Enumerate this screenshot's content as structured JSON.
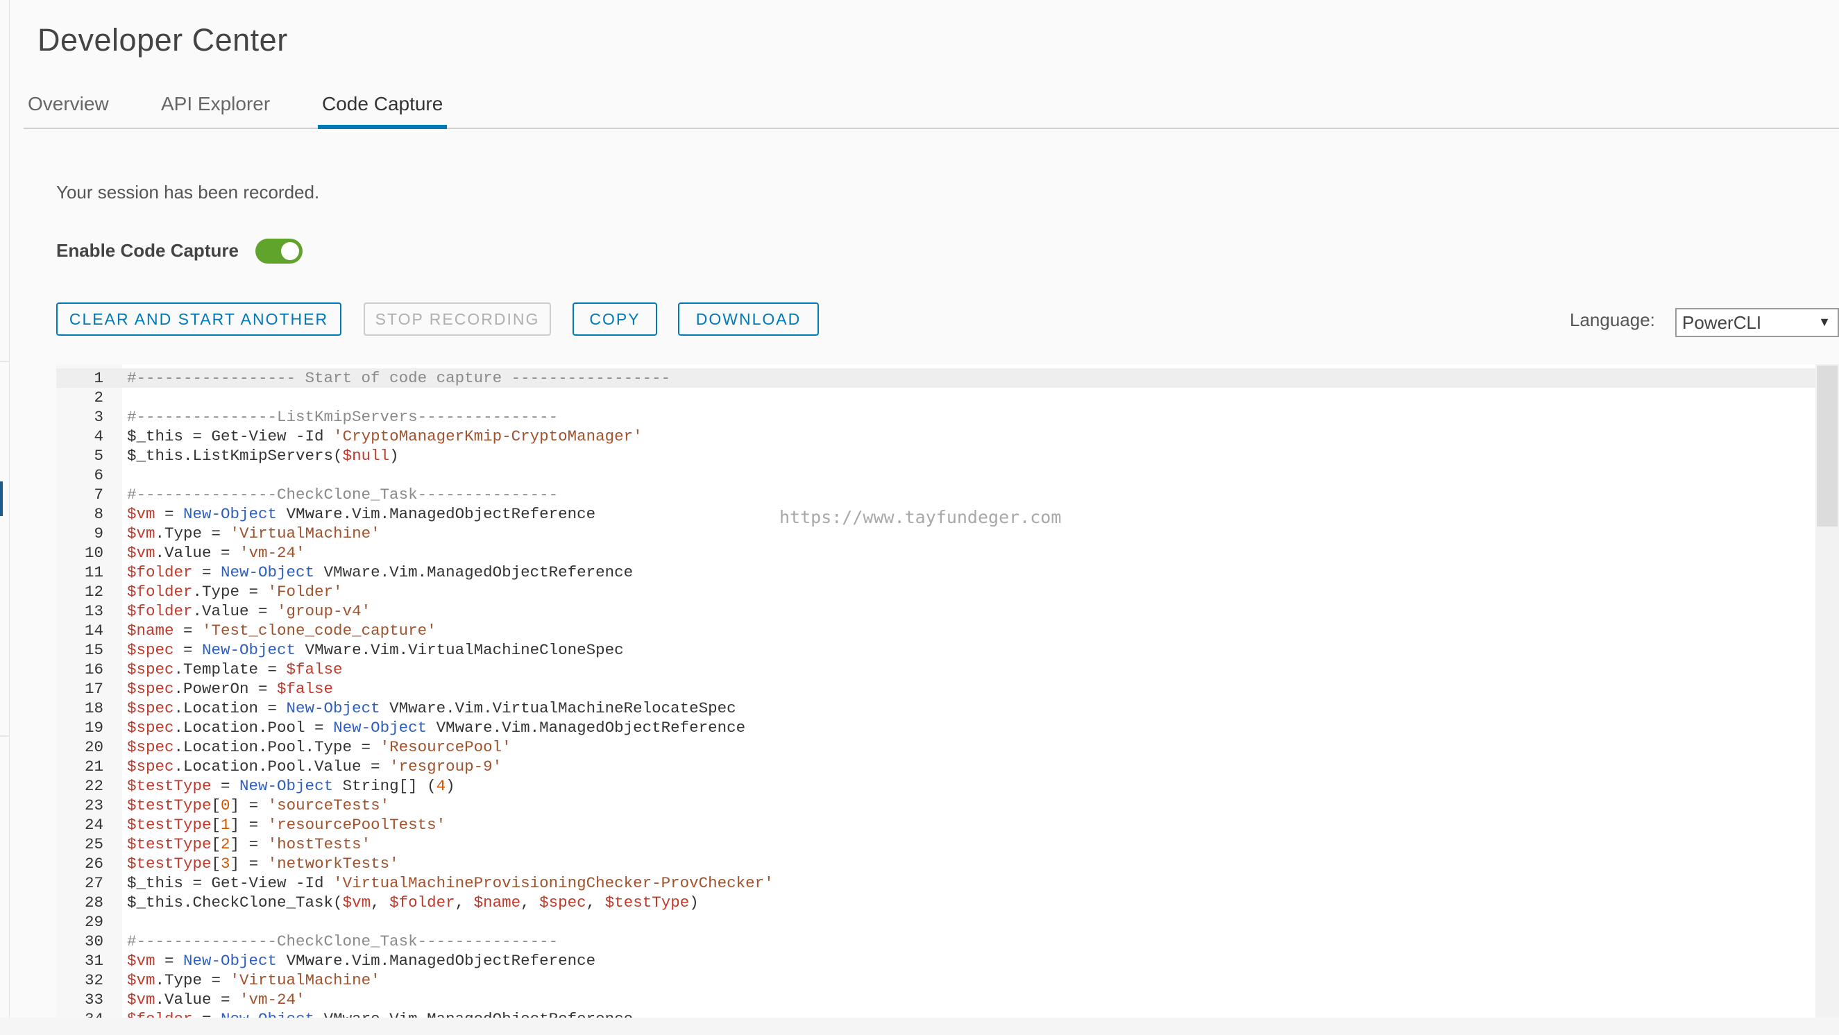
{
  "page": {
    "title": "Developer Center"
  },
  "tabs": [
    {
      "label": "Overview",
      "active": false
    },
    {
      "label": "API Explorer",
      "active": false
    },
    {
      "label": "Code Capture",
      "active": true
    }
  ],
  "session_message": "Your session has been recorded.",
  "toggle": {
    "label": "Enable Code Capture",
    "enabled": true,
    "color": "#61a42b"
  },
  "buttons": {
    "clear_start": "CLEAR AND START ANOTHER",
    "stop_recording": "STOP RECORDING",
    "copy": "COPY",
    "download": "DOWNLOAD"
  },
  "language": {
    "label": "Language:",
    "selected": "PowerCLI"
  },
  "watermark": "https://www.tayfundeger.com",
  "accent_color": "#0079b8",
  "code_lines": [
    [
      [
        "c-com",
        "#----------------- Start of code capture -----------------"
      ]
    ],
    [],
    [
      [
        "c-com",
        "#---------------ListKmipServers---------------"
      ]
    ],
    [
      [
        "",
        "$_this = Get-View -Id "
      ],
      [
        "c-str",
        "'CryptoManagerKmip-CryptoManager'"
      ]
    ],
    [
      [
        "",
        "$_this.ListKmipServers("
      ],
      [
        "c-var",
        "$null"
      ],
      [
        "",
        ")"
      ]
    ],
    [],
    [
      [
        "c-com",
        "#---------------CheckClone_Task---------------"
      ]
    ],
    [
      [
        "c-var",
        "$vm"
      ],
      [
        "",
        " = "
      ],
      [
        "c-kw",
        "New-Object"
      ],
      [
        "",
        " VMware.Vim.ManagedObjectReference"
      ]
    ],
    [
      [
        "c-var",
        "$vm"
      ],
      [
        "",
        ".Type = "
      ],
      [
        "c-str",
        "'VirtualMachine'"
      ]
    ],
    [
      [
        "c-var",
        "$vm"
      ],
      [
        "",
        ".Value = "
      ],
      [
        "c-str",
        "'vm-24'"
      ]
    ],
    [
      [
        "c-var",
        "$folder"
      ],
      [
        "",
        " = "
      ],
      [
        "c-kw",
        "New-Object"
      ],
      [
        "",
        " VMware.Vim.ManagedObjectReference"
      ]
    ],
    [
      [
        "c-var",
        "$folder"
      ],
      [
        "",
        ".Type = "
      ],
      [
        "c-str",
        "'Folder'"
      ]
    ],
    [
      [
        "c-var",
        "$folder"
      ],
      [
        "",
        ".Value = "
      ],
      [
        "c-str",
        "'group-v4'"
      ]
    ],
    [
      [
        "c-var",
        "$name"
      ],
      [
        "",
        " = "
      ],
      [
        "c-str",
        "'Test_clone_code_capture'"
      ]
    ],
    [
      [
        "c-var",
        "$spec"
      ],
      [
        "",
        " = "
      ],
      [
        "c-kw",
        "New-Object"
      ],
      [
        "",
        " VMware.Vim.VirtualMachineCloneSpec"
      ]
    ],
    [
      [
        "c-var",
        "$spec"
      ],
      [
        "",
        ".Template = "
      ],
      [
        "c-var",
        "$false"
      ]
    ],
    [
      [
        "c-var",
        "$spec"
      ],
      [
        "",
        ".PowerOn = "
      ],
      [
        "c-var",
        "$false"
      ]
    ],
    [
      [
        "c-var",
        "$spec"
      ],
      [
        "",
        ".Location = "
      ],
      [
        "c-kw",
        "New-Object"
      ],
      [
        "",
        " VMware.Vim.VirtualMachineRelocateSpec"
      ]
    ],
    [
      [
        "c-var",
        "$spec"
      ],
      [
        "",
        ".Location.Pool = "
      ],
      [
        "c-kw",
        "New-Object"
      ],
      [
        "",
        " VMware.Vim.ManagedObjectReference"
      ]
    ],
    [
      [
        "c-var",
        "$spec"
      ],
      [
        "",
        ".Location.Pool.Type = "
      ],
      [
        "c-str",
        "'ResourcePool'"
      ]
    ],
    [
      [
        "c-var",
        "$spec"
      ],
      [
        "",
        ".Location.Pool.Value = "
      ],
      [
        "c-str",
        "'resgroup-9'"
      ]
    ],
    [
      [
        "c-var",
        "$testType"
      ],
      [
        "",
        " = "
      ],
      [
        "c-kw",
        "New-Object"
      ],
      [
        "",
        " String[] ("
      ],
      [
        "c-num",
        "4"
      ],
      [
        "",
        ")"
      ]
    ],
    [
      [
        "c-var",
        "$testType"
      ],
      [
        "",
        "["
      ],
      [
        "c-num",
        "0"
      ],
      [
        "",
        "] = "
      ],
      [
        "c-str",
        "'sourceTests'"
      ]
    ],
    [
      [
        "c-var",
        "$testType"
      ],
      [
        "",
        "["
      ],
      [
        "c-num",
        "1"
      ],
      [
        "",
        "] = "
      ],
      [
        "c-str",
        "'resourcePoolTests'"
      ]
    ],
    [
      [
        "c-var",
        "$testType"
      ],
      [
        "",
        "["
      ],
      [
        "c-num",
        "2"
      ],
      [
        "",
        "] = "
      ],
      [
        "c-str",
        "'hostTests'"
      ]
    ],
    [
      [
        "c-var",
        "$testType"
      ],
      [
        "",
        "["
      ],
      [
        "c-num",
        "3"
      ],
      [
        "",
        "] = "
      ],
      [
        "c-str",
        "'networkTests'"
      ]
    ],
    [
      [
        "",
        "$_this = Get-View -Id "
      ],
      [
        "c-str",
        "'VirtualMachineProvisioningChecker-ProvChecker'"
      ]
    ],
    [
      [
        "",
        "$_this.CheckClone_Task("
      ],
      [
        "c-var",
        "$vm"
      ],
      [
        "",
        ", "
      ],
      [
        "c-var",
        "$folder"
      ],
      [
        "",
        ", "
      ],
      [
        "c-var",
        "$name"
      ],
      [
        "",
        ", "
      ],
      [
        "c-var",
        "$spec"
      ],
      [
        "",
        ", "
      ],
      [
        "c-var",
        "$testType"
      ],
      [
        "",
        ")"
      ]
    ],
    [],
    [
      [
        "c-com",
        "#---------------CheckClone_Task---------------"
      ]
    ],
    [
      [
        "c-var",
        "$vm"
      ],
      [
        "",
        " = "
      ],
      [
        "c-kw",
        "New-Object"
      ],
      [
        "",
        " VMware.Vim.ManagedObjectReference"
      ]
    ],
    [
      [
        "c-var",
        "$vm"
      ],
      [
        "",
        ".Type = "
      ],
      [
        "c-str",
        "'VirtualMachine'"
      ]
    ],
    [
      [
        "c-var",
        "$vm"
      ],
      [
        "",
        ".Value = "
      ],
      [
        "c-str",
        "'vm-24'"
      ]
    ],
    [
      [
        "c-var",
        "$folder"
      ],
      [
        "",
        " = "
      ],
      [
        "c-kw",
        "New-Object"
      ],
      [
        "",
        " VMware.Vim.ManagedObjectReference"
      ]
    ]
  ]
}
